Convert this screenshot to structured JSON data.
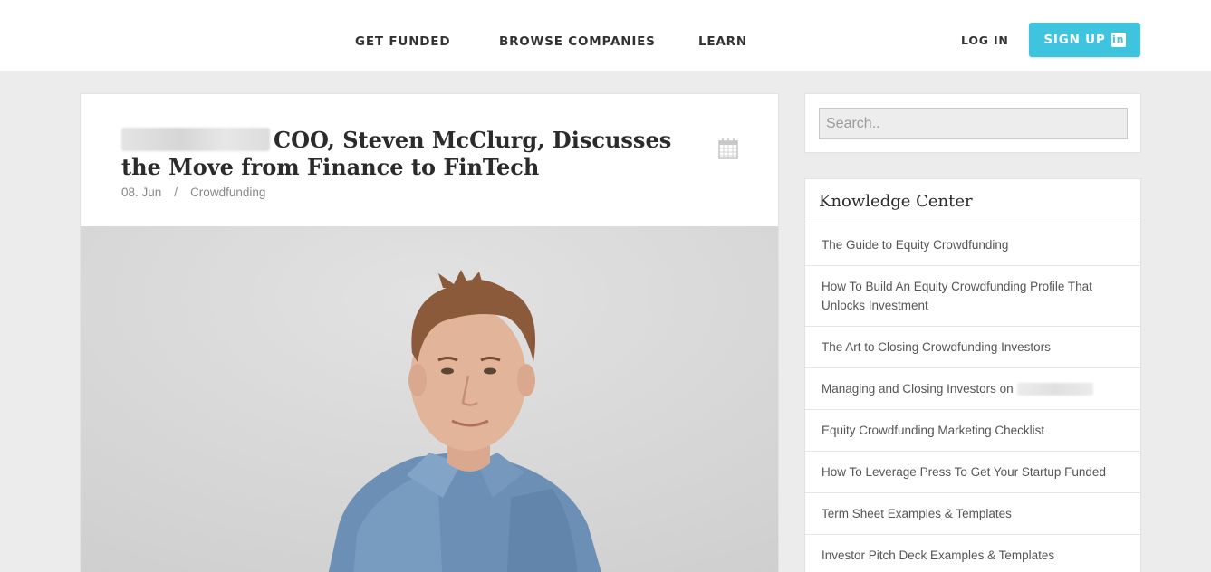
{
  "header": {
    "nav": [
      "GET FUNDED",
      "BROWSE COMPANIES",
      "LEARN"
    ],
    "login_label": "LOG IN",
    "signup_label": "SIGN UP",
    "signup_icon": "linkedin-icon",
    "accent_color": "#3fc4e0"
  },
  "article": {
    "title": "COO, Steven McClurg, Discusses the Move from Finance to FinTech",
    "date": "08. Jun",
    "separator": "/",
    "category": "Crowdfunding",
    "date_icon": "calendar-icon"
  },
  "sidebar": {
    "search_placeholder": "Search..",
    "knowledge_center": {
      "title": "Knowledge Center",
      "items": [
        "The Guide to Equity Crowdfunding",
        "How To Build An Equity Crowdfunding Profile That Unlocks Investment",
        "The Art to Closing Crowdfunding Investors",
        "Managing and Closing Investors on",
        "Equity Crowdfunding Marketing Checklist",
        "How To Leverage Press To Get Your Startup Funded",
        "Term Sheet Examples & Templates",
        "Investor Pitch Deck Examples & Templates"
      ]
    }
  }
}
